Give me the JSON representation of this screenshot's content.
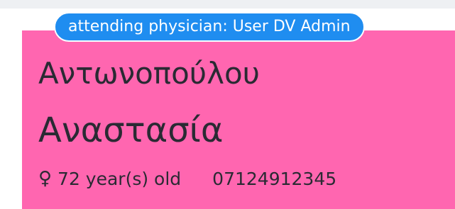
{
  "badge": {
    "text": "attending physician: User DV Admin",
    "color": "#1f8df0"
  },
  "patient": {
    "last_name": "Αντωνοπούλου",
    "first_name": "Αναστασία",
    "gender_icon": "female-icon",
    "gender_symbol": "♀",
    "age_text": "72 year(s) old",
    "phone": "07124912345"
  },
  "colors": {
    "card_background": "#ff66b0",
    "text": "#2a2a33"
  }
}
